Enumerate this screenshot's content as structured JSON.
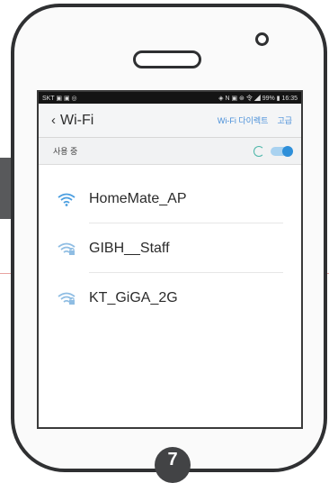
{
  "status_bar": {
    "left": "SKT ▣ ▣ ◎",
    "right": "◈ N ▣ ⊛ 令 ◢ 99% ▮ 16:35"
  },
  "header": {
    "back_icon": "chevron-left-icon",
    "title": "Wi-Fi",
    "action_direct": "Wi-Fi 다이렉트",
    "action_advanced": "고급"
  },
  "toggle": {
    "label": "사용 중",
    "state": "on",
    "accent": "#2e8fd9"
  },
  "networks": [
    {
      "name": "HomeMate_AP",
      "icon": "wifi-open-icon",
      "color": "#4a9ee0"
    },
    {
      "name": "GIBH__Staff",
      "icon": "wifi-locked-icon",
      "color": "#8fbde3"
    },
    {
      "name": "KT_GiGA_2G",
      "icon": "wifi-locked-icon",
      "color": "#8fbde3"
    }
  ],
  "step_badge": "7"
}
